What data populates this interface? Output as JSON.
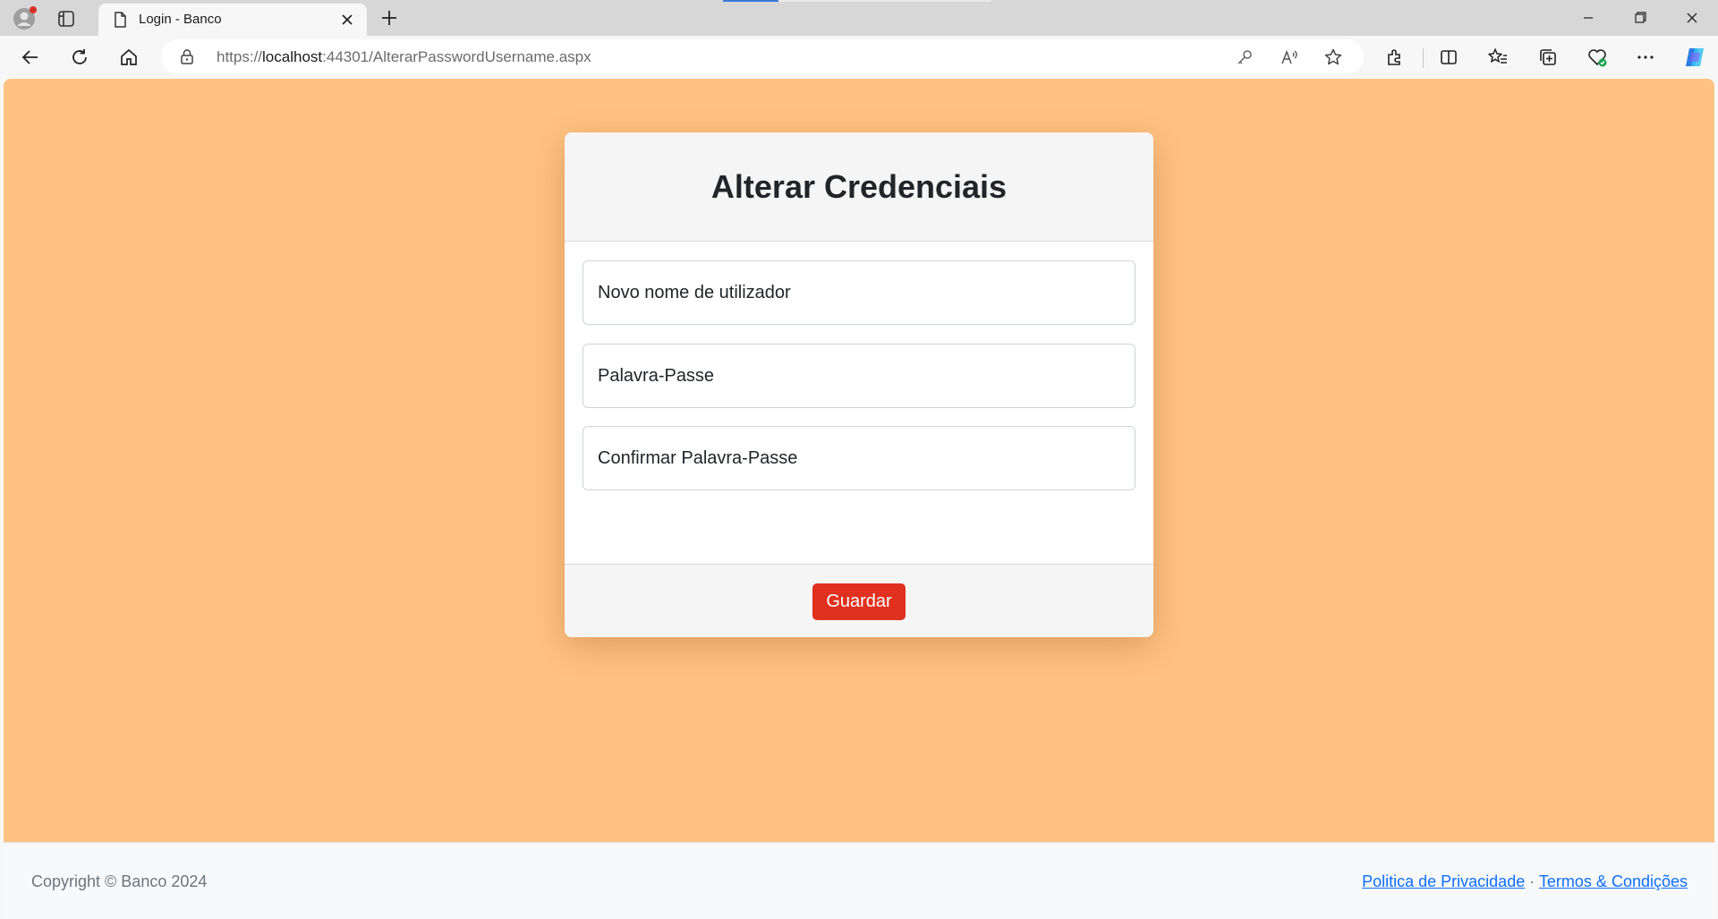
{
  "browser": {
    "tab_title": "Login - Banco",
    "url_prefix": "https://",
    "url_host": "localhost",
    "url_rest": ":44301/AlterarPasswordUsername.aspx",
    "accent_color": "#3b78d8"
  },
  "card": {
    "title": "Alterar Credenciais",
    "fields": {
      "username_placeholder": "Novo nome de utilizador",
      "password_placeholder": "Palavra-Passe",
      "confirm_placeholder": "Confirmar Palavra-Passe"
    },
    "save_label": "Guardar",
    "save_color": "#e0301e"
  },
  "page": {
    "background_color": "#ffc282"
  },
  "footer": {
    "copyright": "Copyright © Banco 2024",
    "privacy_link": "Politica de Privacidade",
    "separator": "·",
    "terms_link": "Termos & Condições"
  }
}
